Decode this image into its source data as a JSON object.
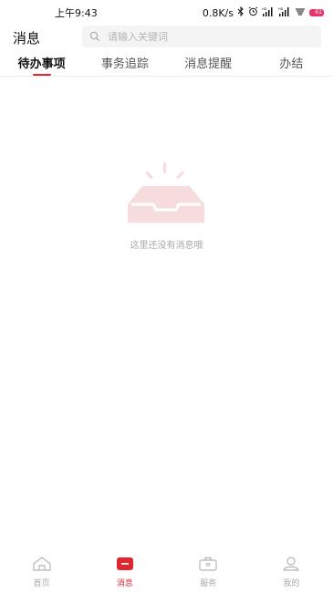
{
  "status_bar": {
    "time": "上午9:43",
    "network_speed": "0.8K/s",
    "signal1_label": "HD",
    "signal2_label": "HD",
    "battery": "61",
    "battery_color": "#e8336b"
  },
  "header": {
    "title": "消息",
    "search_placeholder": "请输入关键词"
  },
  "tabs": [
    {
      "label": "待办事项",
      "active": true
    },
    {
      "label": "事务追踪",
      "active": false
    },
    {
      "label": "消息提醒",
      "active": false
    },
    {
      "label": "办结",
      "active": false
    }
  ],
  "empty_state": {
    "icon": "empty-inbox-icon",
    "message": "这里还没有消息哦"
  },
  "bottom_nav": [
    {
      "label": "首页",
      "icon": "home-icon",
      "active": false
    },
    {
      "label": "消息",
      "icon": "message-icon",
      "active": true
    },
    {
      "label": "服务",
      "icon": "briefcase-icon",
      "active": false
    },
    {
      "label": "我的",
      "icon": "user-icon",
      "active": false
    }
  ],
  "colors": {
    "accent": "#e0262f",
    "empty_icon": "#f6dcdd",
    "inactive": "#a9a9a9"
  }
}
